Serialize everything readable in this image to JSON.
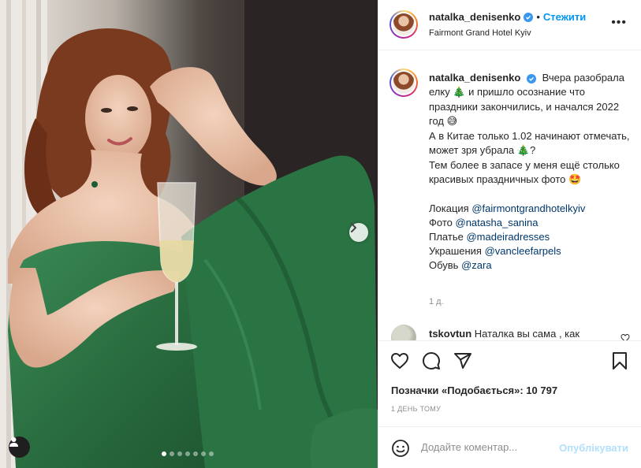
{
  "post": {
    "username": "natalka_denisenko",
    "follow_label": "Стежити",
    "separator": "•",
    "location": "Fairmont Grand Hotel Kyiv",
    "more_label": "•••"
  },
  "caption": {
    "username": "natalka_denisenko",
    "line1": "Вчера разобрала елку",
    "emoji_tree": "🎄",
    "line1b": "и пришло осознание что праздники закончились, и начался 2022 год",
    "emoji_smile": "😅",
    "line2": "А в Китае только 1.02 начинают отмечать, может зря убрала",
    "line2_end": "?",
    "line3": "Тем более в запасе у меня ещё столько красивых праздничных фото",
    "emoji_star": "🤩",
    "credits": [
      {
        "label": "Локация",
        "handle": "@fairmontgrandhotelkyiv"
      },
      {
        "label": "Фото",
        "handle": "@natasha_sanina"
      },
      {
        "label": "Платье",
        "handle": "@madeiradresses"
      },
      {
        "label": "Украшения",
        "handle": "@vancleefarpels"
      },
      {
        "label": "Обувь",
        "handle": "@zara"
      }
    ],
    "time": "1 д."
  },
  "comment": {
    "username": "tskovtun",
    "text": "Наталка вы сама , как"
  },
  "likes": "Позначки «Подобається»: 10 797",
  "date": "1 ДЕНЬ ТОМУ",
  "add_comment": {
    "placeholder": "Додайте коментар...",
    "post_label": "Опублікувати"
  },
  "carousel": {
    "count": 7,
    "active_index": 0
  },
  "icons": [
    "tag-user-icon",
    "next-arrow-icon",
    "verified-icon",
    "more-icon",
    "heart-icon",
    "comment-icon",
    "share-icon",
    "bookmark-icon",
    "smiley-icon"
  ],
  "colors": {
    "accent": "#0095f6",
    "link": "#00376b",
    "muted": "#8e8e8e",
    "verified": "#3897f0",
    "dress": "#2f7a48"
  }
}
